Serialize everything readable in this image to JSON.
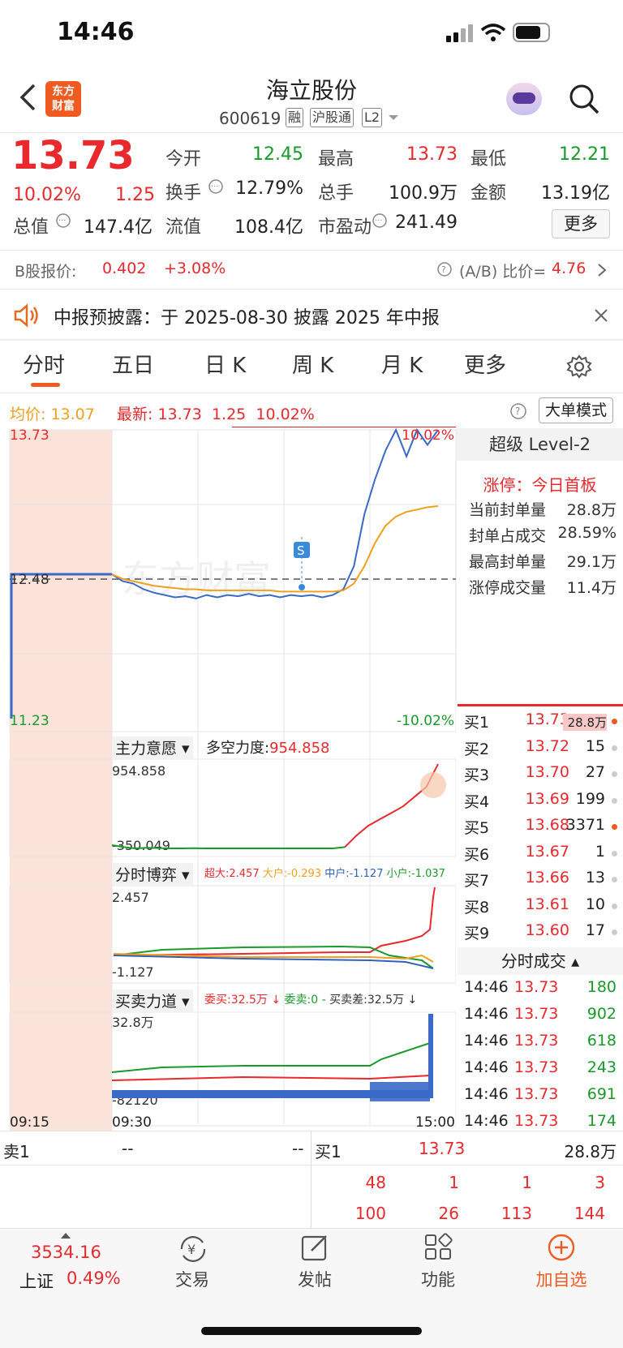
{
  "status": {
    "time": "14:46"
  },
  "header": {
    "title": "海立股份",
    "code": "600619",
    "tags": [
      "融",
      "沪股通",
      "L2"
    ],
    "logo_line1": "东方",
    "logo_line2": "财富"
  },
  "quote": {
    "price": "13.73",
    "change_pct": "10.02%",
    "change": "1.25",
    "rows": [
      [
        {
          "label": "今开",
          "value": "12.45",
          "color": "green"
        },
        {
          "label": "最高",
          "value": "13.73",
          "color": "red"
        },
        {
          "label": "最低",
          "value": "12.21",
          "color": "green"
        }
      ],
      [
        {
          "label": "换手",
          "value": "12.79%"
        },
        {
          "label": "总手",
          "value": "100.9万"
        },
        {
          "label": "金额",
          "value": "13.19亿"
        }
      ],
      [
        {
          "label": "总值",
          "value": "147.4亿"
        },
        {
          "label": "流值",
          "value": "108.4亿"
        },
        {
          "label": "市盈动",
          "value": "241.49"
        }
      ]
    ],
    "more_button": "更多"
  },
  "bshare": {
    "label": "B股报价:",
    "price": "0.402",
    "pct": "+3.08%",
    "ratio_label": "(A/B) 比价=",
    "ratio": "4.76"
  },
  "notice": {
    "text": "中报预披露：于 2025-08-30 披露 2025 年中报"
  },
  "tabs": [
    "分时",
    "五日",
    "日 K",
    "周 K",
    "月 K",
    "更多"
  ],
  "chart_header": {
    "avg_label": "均价:",
    "avg": "13.07",
    "latest_label": "最新:",
    "latest": "13.73",
    "chg": "1.25",
    "pct": "10.02%",
    "mode_button": "大单模式"
  },
  "chart_data": [
    {
      "type": "line",
      "y_ticks_left": [
        "13.73",
        "12.48",
        "11.23"
      ],
      "y_ticks_right": [
        "10.02%",
        "-10.02%"
      ],
      "x_ticks": [
        "09:15",
        "09:30",
        "15:00"
      ],
      "ylim": [
        11.23,
        13.73
      ],
      "reference": 12.48,
      "series": [
        {
          "values": [
            12.48,
            12.42,
            12.4,
            12.35,
            12.32,
            12.3,
            12.28,
            12.29,
            12.27,
            12.3,
            12.28,
            12.3,
            12.29,
            12.31,
            12.29,
            12.3,
            12.28,
            12.3,
            12.29,
            12.3,
            12.28,
            12.3,
            12.35,
            12.55,
            13.0,
            13.3,
            13.55,
            13.73,
            13.5,
            13.73,
            13.6,
            13.73
          ]
        },
        {
          "values": [
            12.48,
            12.44,
            12.42,
            12.4,
            12.38,
            12.37,
            12.36,
            12.35,
            12.35,
            12.34,
            12.34,
            12.34,
            12.34,
            12.34,
            12.34,
            12.34,
            12.33,
            12.33,
            12.33,
            12.33,
            12.33,
            12.33,
            12.34,
            12.4,
            12.55,
            12.75,
            12.9,
            12.98,
            13.02,
            13.04,
            13.06,
            13.07
          ]
        }
      ]
    },
    {
      "type": "line",
      "panel_label": "主力意愿",
      "value_label": "多空力度:",
      "value": "954.858",
      "y_ticks": [
        "954.858",
        "-350.049"
      ],
      "ylim": [
        -350.049,
        954.858
      ],
      "series": [
        {
          "values": [
            -300,
            -330,
            -350,
            -340,
            -345,
            -350,
            -350,
            -348,
            -350,
            -350,
            -350,
            -350,
            -350,
            -350,
            -350,
            -350,
            -350,
            -350,
            -350,
            -350,
            -330,
            -150,
            0,
            100,
            200,
            300,
            450,
            600,
            954
          ]
        }
      ]
    },
    {
      "type": "line",
      "panel_label": "分时博弈",
      "legend": [
        {
          "name": "超大:2.457",
          "color": "#e8292d"
        },
        {
          "name": "大户:-0.293",
          "color": "#f0a020"
        },
        {
          "name": "中户:-1.127",
          "color": "#3060c0"
        },
        {
          "name": "小户:-1.037",
          "color": "#1a9a2a"
        }
      ],
      "y_ticks": [
        "2.457",
        "-1.127"
      ],
      "ylim": [
        -1.127,
        2.457
      ]
    },
    {
      "type": "line",
      "panel_label": "买卖力道",
      "legend": [
        {
          "name": "委买:32.5万 ↓",
          "color": "#e8292d"
        },
        {
          "name": "委卖:0 -",
          "color": "#1a9a2a"
        },
        {
          "name": "买卖差:32.5万 ↓",
          "color": "#333"
        }
      ],
      "y_ticks": [
        "32.8万",
        "-82120"
      ]
    }
  ],
  "level2": {
    "title": "超级 Level-2",
    "limit_label": "涨停：今日首板",
    "rows": [
      {
        "label": "当前封单量",
        "value": "28.8万"
      },
      {
        "label": "封单占成交",
        "value": "28.59%"
      },
      {
        "label": "最高封单量",
        "value": "29.1万"
      },
      {
        "label": "涨停成交量",
        "value": "11.4万"
      }
    ]
  },
  "bids": [
    {
      "label": "买1",
      "price": "13.73",
      "vol": "28.8万"
    },
    {
      "label": "买2",
      "price": "13.72",
      "vol": "15"
    },
    {
      "label": "买3",
      "price": "13.70",
      "vol": "27"
    },
    {
      "label": "买4",
      "price": "13.69",
      "vol": "199"
    },
    {
      "label": "买5",
      "price": "13.68",
      "vol": "3371"
    },
    {
      "label": "买6",
      "price": "13.67",
      "vol": "1"
    },
    {
      "label": "买7",
      "price": "13.66",
      "vol": "13"
    },
    {
      "label": "买8",
      "price": "13.61",
      "vol": "10"
    },
    {
      "label": "买9",
      "price": "13.60",
      "vol": "17"
    }
  ],
  "trades_title": "分时成交",
  "trades": [
    {
      "time": "14:46",
      "price": "13.73",
      "vol": "180"
    },
    {
      "time": "14:46",
      "price": "13.73",
      "vol": "902"
    },
    {
      "time": "14:46",
      "price": "13.73",
      "vol": "618"
    },
    {
      "time": "14:46",
      "price": "13.73",
      "vol": "243"
    },
    {
      "time": "14:46",
      "price": "13.73",
      "vol": "691"
    },
    {
      "time": "14:46",
      "price": "13.73",
      "vol": "174"
    }
  ],
  "queue": {
    "sell_label": "卖1",
    "sell_price": "--",
    "sell_vol": "--",
    "buy_label": "买1",
    "buy_price": "13.73",
    "buy_vol": "28.8万",
    "row1": [
      "48",
      "1",
      "1",
      "3"
    ],
    "row2": [
      "100",
      "26",
      "113",
      "144"
    ]
  },
  "bottom": {
    "index_value": "3534.16",
    "index_name": "上证",
    "index_pct": "0.49%",
    "nav": [
      "交易",
      "发帖",
      "功能",
      "加自选"
    ]
  }
}
